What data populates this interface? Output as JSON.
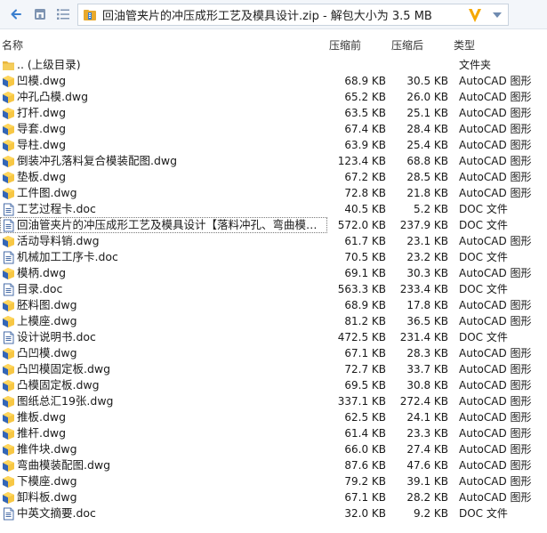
{
  "toolbar": {
    "address": "回油管夹片的冲压成形工艺及模具设计.zip - 解包大小为 3.5 MB",
    "back_icon": "back-arrow-icon",
    "home_icon": "home-icon",
    "view_icon": "list-view-icon",
    "colors": {
      "accent": "#f5a800",
      "v_logo": "#f5a800",
      "arrow": "#3a7fcf"
    }
  },
  "header": {
    "name": "名称",
    "compressed": "压缩前",
    "original": "压缩后",
    "type": "类型"
  },
  "files": [
    {
      "name": ".. (上级目录)",
      "size": "",
      "packed": "",
      "type": "文件夹",
      "icon": "folder"
    },
    {
      "name": "凹模.dwg",
      "size": "68.9 KB",
      "packed": "30.5 KB",
      "type": "AutoCAD 图形",
      "icon": "dwg"
    },
    {
      "name": "冲孔凸模.dwg",
      "size": "65.2 KB",
      "packed": "26.0 KB",
      "type": "AutoCAD 图形",
      "icon": "dwg"
    },
    {
      "name": "打杆.dwg",
      "size": "63.5 KB",
      "packed": "25.1 KB",
      "type": "AutoCAD 图形",
      "icon": "dwg"
    },
    {
      "name": "导套.dwg",
      "size": "67.4 KB",
      "packed": "28.4 KB",
      "type": "AutoCAD 图形",
      "icon": "dwg"
    },
    {
      "name": "导柱.dwg",
      "size": "63.9 KB",
      "packed": "25.4 KB",
      "type": "AutoCAD 图形",
      "icon": "dwg"
    },
    {
      "name": "倒装冲孔落料复合模装配图.dwg",
      "size": "123.4 KB",
      "packed": "68.8 KB",
      "type": "AutoCAD 图形",
      "icon": "dwg"
    },
    {
      "name": "垫板.dwg",
      "size": "67.2 KB",
      "packed": "28.5 KB",
      "type": "AutoCAD 图形",
      "icon": "dwg"
    },
    {
      "name": "工件图.dwg",
      "size": "72.8 KB",
      "packed": "21.8 KB",
      "type": "AutoCAD 图形",
      "icon": "dwg"
    },
    {
      "name": "工艺过程卡.doc",
      "size": "40.5 KB",
      "packed": "5.2 KB",
      "type": "DOC 文件",
      "icon": "doc"
    },
    {
      "name": "回油管夹片的冲压成形工艺及模具设计【落料冲孔、弯曲模复合...",
      "size": "572.0 KB",
      "packed": "237.9 KB",
      "type": "DOC 文件",
      "icon": "doc",
      "selected": true
    },
    {
      "name": "活动导料销.dwg",
      "size": "61.7 KB",
      "packed": "23.1 KB",
      "type": "AutoCAD 图形",
      "icon": "dwg"
    },
    {
      "name": "机械加工工序卡.doc",
      "size": "70.5 KB",
      "packed": "23.2 KB",
      "type": "DOC 文件",
      "icon": "doc"
    },
    {
      "name": "模柄.dwg",
      "size": "69.1 KB",
      "packed": "30.3 KB",
      "type": "AutoCAD 图形",
      "icon": "dwg"
    },
    {
      "name": "目录.doc",
      "size": "563.3 KB",
      "packed": "233.4 KB",
      "type": "DOC 文件",
      "icon": "doc"
    },
    {
      "name": "胚料图.dwg",
      "size": "68.9 KB",
      "packed": "17.8 KB",
      "type": "AutoCAD 图形",
      "icon": "dwg"
    },
    {
      "name": "上模座.dwg",
      "size": "81.2 KB",
      "packed": "36.5 KB",
      "type": "AutoCAD 图形",
      "icon": "dwg"
    },
    {
      "name": "设计说明书.doc",
      "size": "472.5 KB",
      "packed": "231.4 KB",
      "type": "DOC 文件",
      "icon": "doc"
    },
    {
      "name": "凸凹模.dwg",
      "size": "67.1 KB",
      "packed": "28.3 KB",
      "type": "AutoCAD 图形",
      "icon": "dwg"
    },
    {
      "name": "凸凹模固定板.dwg",
      "size": "72.7 KB",
      "packed": "33.7 KB",
      "type": "AutoCAD 图形",
      "icon": "dwg"
    },
    {
      "name": "凸模固定板.dwg",
      "size": "69.5 KB",
      "packed": "30.8 KB",
      "type": "AutoCAD 图形",
      "icon": "dwg"
    },
    {
      "name": "图纸总汇19张.dwg",
      "size": "337.1 KB",
      "packed": "272.4 KB",
      "type": "AutoCAD 图形",
      "icon": "dwg"
    },
    {
      "name": "推板.dwg",
      "size": "62.5 KB",
      "packed": "24.1 KB",
      "type": "AutoCAD 图形",
      "icon": "dwg"
    },
    {
      "name": "推杆.dwg",
      "size": "61.4 KB",
      "packed": "23.3 KB",
      "type": "AutoCAD 图形",
      "icon": "dwg"
    },
    {
      "name": "推件块.dwg",
      "size": "66.0 KB",
      "packed": "27.4 KB",
      "type": "AutoCAD 图形",
      "icon": "dwg"
    },
    {
      "name": "弯曲模装配图.dwg",
      "size": "87.6 KB",
      "packed": "47.6 KB",
      "type": "AutoCAD 图形",
      "icon": "dwg"
    },
    {
      "name": "下模座.dwg",
      "size": "79.2 KB",
      "packed": "39.1 KB",
      "type": "AutoCAD 图形",
      "icon": "dwg"
    },
    {
      "name": "卸料板.dwg",
      "size": "67.1 KB",
      "packed": "28.2 KB",
      "type": "AutoCAD 图形",
      "icon": "dwg"
    },
    {
      "name": "中英文摘要.doc",
      "size": "32.0 KB",
      "packed": "9.2 KB",
      "type": "DOC 文件",
      "icon": "doc"
    }
  ]
}
